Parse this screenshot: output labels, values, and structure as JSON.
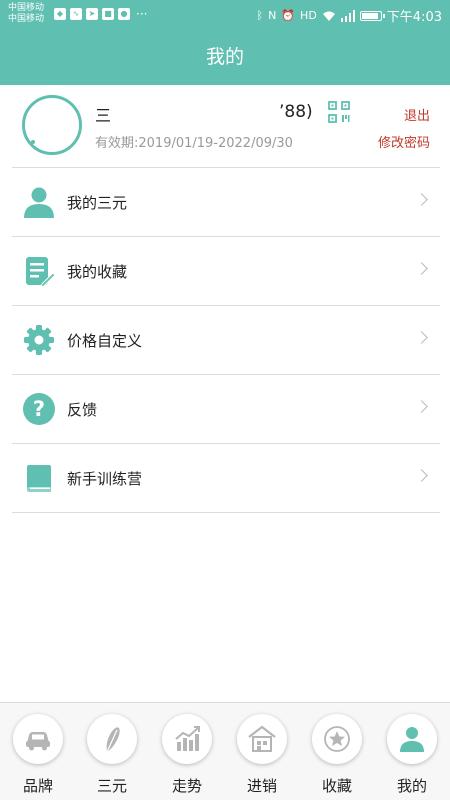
{
  "status_bar": {
    "carrier1": "中国移动",
    "carrier2": "中国移动",
    "more": "···",
    "time": "下午4:03",
    "icons": [
      "shield-icon",
      "pulse-icon",
      "send-icon",
      "app-icon",
      "wechat-icon",
      "bluetooth-icon",
      "nfc-icon",
      "alarm-icon",
      "hd-icon",
      "wifi-icon",
      "signal-icon",
      "battery-icon"
    ]
  },
  "header": {
    "title": "我的"
  },
  "profile": {
    "name": "三",
    "phone": "’88)",
    "validity": "有效期:2019/01/19-2022/09/30",
    "logout_label": "退出",
    "change_password_label": "修改密码"
  },
  "menu": [
    {
      "label": "我的三元",
      "icon": "user-icon"
    },
    {
      "label": "我的收藏",
      "icon": "edit-document-icon"
    },
    {
      "label": "价格自定义",
      "icon": "gear-icon"
    },
    {
      "label": "反馈",
      "icon": "help-icon"
    },
    {
      "label": "新手训练营",
      "icon": "book-icon"
    }
  ],
  "tabs": [
    {
      "label": "品牌",
      "icon": "car-icon"
    },
    {
      "label": "三元",
      "icon": "feather-icon"
    },
    {
      "label": "走势",
      "icon": "trend-chart-icon"
    },
    {
      "label": "进销",
      "icon": "warehouse-icon"
    },
    {
      "label": "收藏",
      "icon": "star-icon"
    },
    {
      "label": "我的",
      "icon": "user-icon",
      "active": true
    }
  ],
  "colors": {
    "primary": "#5fbfb0",
    "accent_red": "#c0392b",
    "icon_gray": "#b5b5b5"
  }
}
